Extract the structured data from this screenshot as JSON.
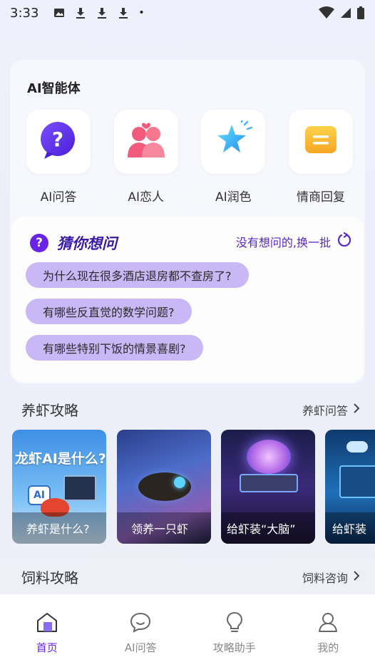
{
  "status": {
    "time": "3:33",
    "dot": "•",
    "icons": [
      "image-icon",
      "download-icon",
      "download-icon",
      "download-icon",
      "wifi-icon",
      "signal-icon",
      "battery-icon"
    ]
  },
  "agents": {
    "title": "AI智能体",
    "items": [
      {
        "label": "AI问答",
        "icon": "question-bubble-icon"
      },
      {
        "label": "AI恋人",
        "icon": "couple-icon"
      },
      {
        "label": "AI润色",
        "icon": "sparkle-star-icon"
      },
      {
        "label": "情商回复",
        "icon": "message-card-icon"
      }
    ]
  },
  "guess": {
    "badge": "?",
    "title": "猜你想问",
    "refresh_label": "没有想问的,换一批",
    "questions": [
      "为什么现在很多酒店退房都不查房了?",
      "有哪些反直觉的数学问题?",
      "有哪些特别下饭的情景喜剧?"
    ]
  },
  "shrimp_section": {
    "title": "养虾攻略",
    "more_label": "养虾问答",
    "cards": [
      {
        "caption": "养虾是什么?",
        "banner": "龙虾AI是什么?",
        "badge": "AI"
      },
      {
        "caption": "领养一只虾"
      },
      {
        "caption": "给虾装“大脑”"
      },
      {
        "caption": "给虾装"
      }
    ]
  },
  "feed_section": {
    "title": "饲料攻略",
    "more_label": "饲料咨询"
  },
  "tabs": [
    {
      "label": "首页",
      "active": true,
      "icon": "home-icon"
    },
    {
      "label": "AI问答",
      "active": false,
      "icon": "chat-icon"
    },
    {
      "label": "攻略助手",
      "active": false,
      "icon": "lightbulb-icon"
    },
    {
      "label": "我的",
      "active": false,
      "icon": "user-icon"
    }
  ],
  "colors": {
    "accent": "#6a22e6",
    "pill": "#c9b8f5",
    "title_purple": "#3a1aa8"
  }
}
